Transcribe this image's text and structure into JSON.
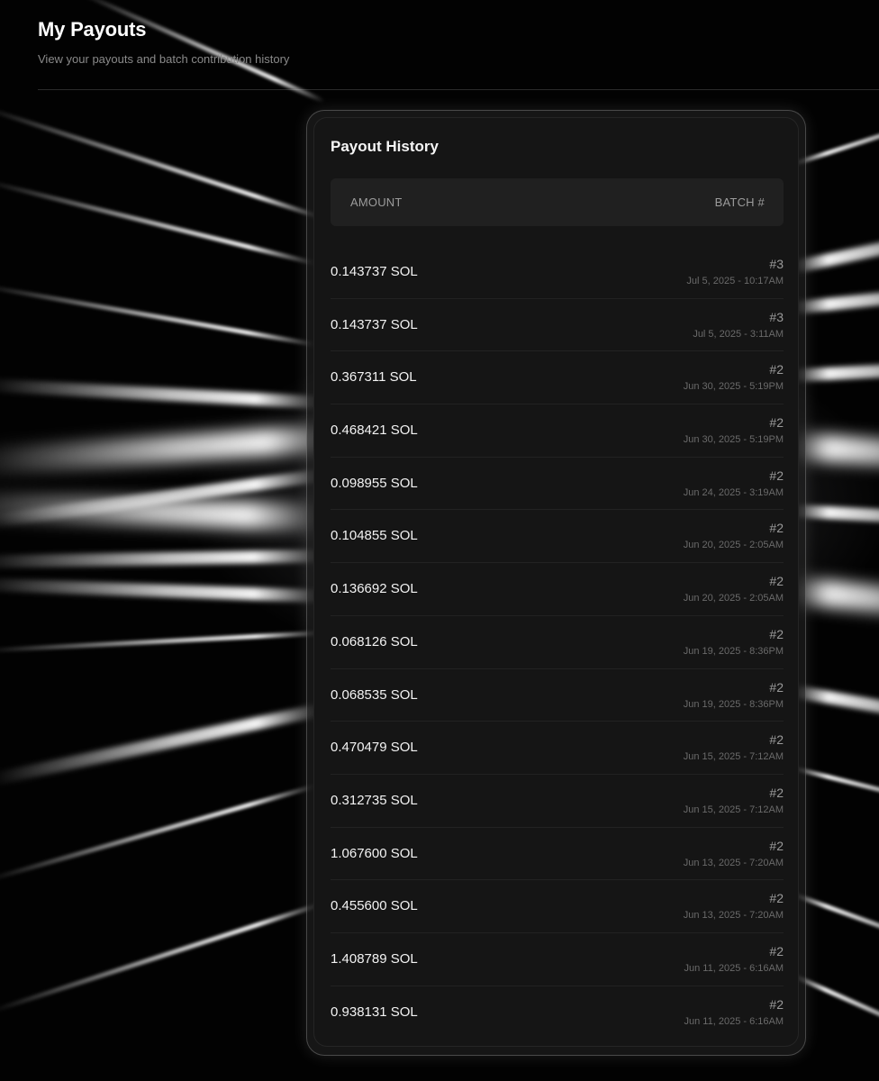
{
  "header": {
    "title": "My Payouts",
    "subtitle": "View your payouts and batch contribution history"
  },
  "payout_history": {
    "title": "Payout History",
    "columns": {
      "amount": "AMOUNT",
      "batch": "BATCH #"
    },
    "rows": [
      {
        "amount": "0.143737 SOL",
        "batch": "#3",
        "date": "Jul 5, 2025 - 10:17AM"
      },
      {
        "amount": "0.143737 SOL",
        "batch": "#3",
        "date": "Jul 5, 2025 - 3:11AM"
      },
      {
        "amount": "0.367311 SOL",
        "batch": "#2",
        "date": "Jun 30, 2025 - 5:19PM"
      },
      {
        "amount": "0.468421 SOL",
        "batch": "#2",
        "date": "Jun 30, 2025 - 5:19PM"
      },
      {
        "amount": "0.098955 SOL",
        "batch": "#2",
        "date": "Jun 24, 2025 - 3:19AM"
      },
      {
        "amount": "0.104855 SOL",
        "batch": "#2",
        "date": "Jun 20, 2025 - 2:05AM"
      },
      {
        "amount": "0.136692 SOL",
        "batch": "#2",
        "date": "Jun 20, 2025 - 2:05AM"
      },
      {
        "amount": "0.068126 SOL",
        "batch": "#2",
        "date": "Jun 19, 2025 - 8:36PM"
      },
      {
        "amount": "0.068535 SOL",
        "batch": "#2",
        "date": "Jun 19, 2025 - 8:36PM"
      },
      {
        "amount": "0.470479 SOL",
        "batch": "#2",
        "date": "Jun 15, 2025 - 7:12AM"
      },
      {
        "amount": "0.312735 SOL",
        "batch": "#2",
        "date": "Jun 15, 2025 - 7:12AM"
      },
      {
        "amount": "1.067600 SOL",
        "batch": "#2",
        "date": "Jun 13, 2025 - 7:20AM"
      },
      {
        "amount": "0.455600 SOL",
        "batch": "#2",
        "date": "Jun 13, 2025 - 7:20AM"
      },
      {
        "amount": "1.408789 SOL",
        "batch": "#2",
        "date": "Jun 11, 2025 - 6:16AM"
      },
      {
        "amount": "0.938131 SOL",
        "batch": "#2",
        "date": "Jun 11, 2025 - 6:16AM"
      }
    ]
  }
}
